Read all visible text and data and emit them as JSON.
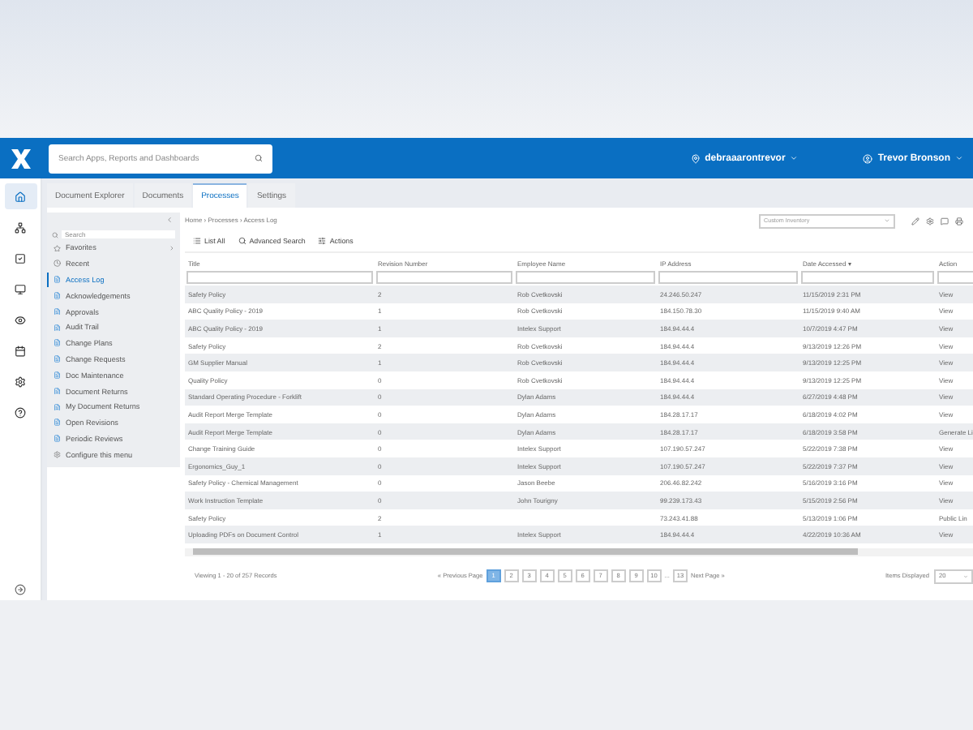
{
  "header": {
    "search": {
      "placeholder": "Search Apps, Reports and Dashboards"
    },
    "location": "debraaarontrevor",
    "user": "Trevor Bronson"
  },
  "rail": [
    {
      "kind": "home",
      "selected": true
    },
    {
      "kind": "network",
      "selected": false
    },
    {
      "kind": "check",
      "selected": false
    },
    {
      "kind": "monitor",
      "selected": false
    },
    {
      "kind": "eye",
      "selected": false
    },
    {
      "kind": "calendar",
      "selected": false
    },
    {
      "kind": "gear",
      "selected": false
    },
    {
      "kind": "help",
      "selected": false
    }
  ],
  "tabs": [
    {
      "label": "Document Explorer",
      "selected": false
    },
    {
      "label": "Documents",
      "selected": false
    },
    {
      "label": "Processes",
      "selected": true
    },
    {
      "label": "Settings",
      "selected": false
    }
  ],
  "sidebar": {
    "search": {
      "placeholder": "Search"
    },
    "items": [
      {
        "kind": "favorites",
        "label": "Favorites",
        "selected": false
      },
      {
        "kind": "recent",
        "label": "Recent",
        "selected": false
      },
      {
        "kind": "item",
        "label": "Access Log",
        "selected": true
      },
      {
        "kind": "item",
        "label": "Acknowledgements",
        "selected": false
      },
      {
        "kind": "item",
        "label": "Approvals",
        "selected": false
      },
      {
        "kind": "item",
        "label": "Audit Trail",
        "selected": false
      },
      {
        "kind": "item",
        "label": "Change Plans",
        "selected": false
      },
      {
        "kind": "item",
        "label": "Change Requests",
        "selected": false
      },
      {
        "kind": "item",
        "label": "Doc Maintenance",
        "selected": false
      },
      {
        "kind": "item",
        "label": "Document Returns",
        "selected": false
      },
      {
        "kind": "item",
        "label": "My Document Returns",
        "selected": false
      },
      {
        "kind": "item",
        "label": "Open Revisions",
        "selected": false
      },
      {
        "kind": "item",
        "label": "Periodic Reviews",
        "selected": false
      },
      {
        "kind": "configure",
        "label": "Configure this menu",
        "selected": false
      }
    ]
  },
  "breadcrumb": "Home › Processes › Access Log",
  "view_select": "Custom Inventory",
  "toolbar": [
    "List All",
    "Advanced Search",
    "Actions"
  ],
  "table": {
    "columns": [
      "Title",
      "Revision Number",
      "Employee Name",
      "IP Address",
      "Date Accessed ▾",
      "Action"
    ],
    "rows": [
      [
        "Safety Policy",
        "2",
        "Rob Cvetkovski",
        "24.246.50.247",
        "11/15/2019 2:31 PM",
        "View"
      ],
      [
        "ABC Quality Policy - 2019",
        "1",
        "Rob Cvetkovski",
        "184.150.78.30",
        "11/15/2019 9:40 AM",
        "View"
      ],
      [
        "ABC Quality Policy - 2019",
        "1",
        "Intelex Support",
        "184.94.44.4",
        "10/7/2019 4:47 PM",
        "View"
      ],
      [
        "Safety Policy",
        "2",
        "Rob Cvetkovski",
        "184.94.44.4",
        "9/13/2019 12:26 PM",
        "View"
      ],
      [
        "GM Supplier Manual",
        "1",
        "Rob Cvetkovski",
        "184.94.44.4",
        "9/13/2019 12:25 PM",
        "View"
      ],
      [
        "Quality Policy",
        "0",
        "Rob Cvetkovski",
        "184.94.44.4",
        "9/13/2019 12:25 PM",
        "View"
      ],
      [
        "Standard Operating Procedure - Forklift",
        "0",
        "Dylan Adams",
        "184.94.44.4",
        "6/27/2019 4:48 PM",
        "View"
      ],
      [
        "Audit Report Merge Template",
        "0",
        "Dylan Adams",
        "184.28.17.17",
        "6/18/2019 4:02 PM",
        "View"
      ],
      [
        "Audit Report Merge Template",
        "0",
        "Dylan Adams",
        "184.28.17.17",
        "6/18/2019 3:58 PM",
        "Generate Li"
      ],
      [
        "Change Training Guide",
        "0",
        "Intelex Support",
        "107.190.57.247",
        "5/22/2019 7:38 PM",
        "View"
      ],
      [
        "Ergonomics_Guy_1",
        "0",
        "Intelex Support",
        "107.190.57.247",
        "5/22/2019 7:37 PM",
        "View"
      ],
      [
        "Safety Policy - Chemical Management",
        "0",
        "Jason Beebe",
        "206.46.82.242",
        "5/16/2019 3:16 PM",
        "View"
      ],
      [
        "Work Instruction Template",
        "0",
        "John Tourigny",
        "99.239.173.43",
        "5/15/2019 2:56 PM",
        "View"
      ],
      [
        "Safety Policy",
        "2",
        "",
        "73.243.41.88",
        "5/13/2019 1:06 PM",
        "Public Lin"
      ],
      [
        "Uploading PDFs on Document Control",
        "1",
        "Intelex Support",
        "184.94.44.4",
        "4/22/2019 10:36 AM",
        "View"
      ]
    ]
  },
  "footer": {
    "summary": "Viewing 1 - 20 of 257 Records",
    "previous": "« Previous Page",
    "pages": [
      {
        "label": "1",
        "selected": true
      },
      {
        "label": "2",
        "selected": false
      },
      {
        "label": "3",
        "selected": false
      },
      {
        "label": "4",
        "selected": false
      },
      {
        "label": "5",
        "selected": false
      },
      {
        "label": "6",
        "selected": false
      },
      {
        "label": "7",
        "selected": false
      },
      {
        "label": "8",
        "selected": false
      },
      {
        "label": "9",
        "selected": false
      },
      {
        "label": "10",
        "selected": false
      }
    ],
    "ellipsis": "...",
    "last_page": "13",
    "next": "Next Page »",
    "items_label": "Items Displayed",
    "items_value": "20"
  }
}
